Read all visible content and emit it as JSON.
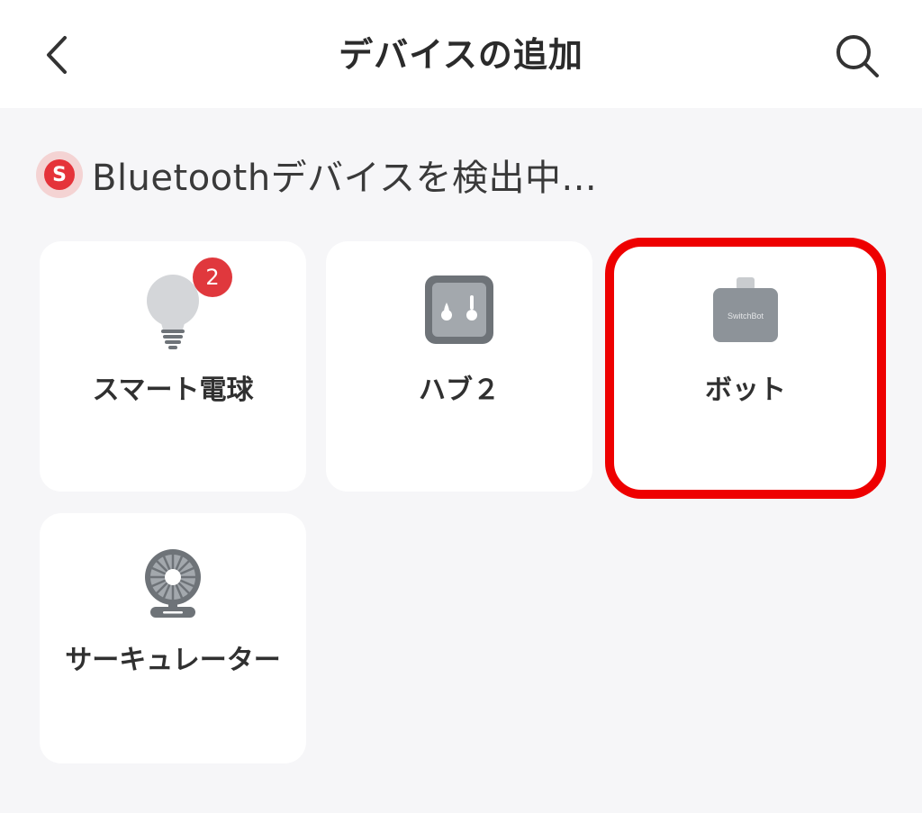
{
  "header": {
    "title": "デバイスの追加"
  },
  "scan": {
    "logo_letter": "S",
    "status_text": "Bluetoothデバイスを検出中..."
  },
  "devices": [
    {
      "label": "スマート電球",
      "icon": "light-bulb-icon",
      "badge": "2"
    },
    {
      "label": "ハブ２",
      "icon": "hub-icon"
    },
    {
      "label": "ボット",
      "icon": "switchbot-bot-icon",
      "icon_text": "SwitchBot",
      "highlighted": true
    },
    {
      "label": "サーキュレーター",
      "icon": "circulator-fan-icon"
    }
  ],
  "colors": {
    "accent_red": "#e0383d",
    "highlight": "#ee0000",
    "icon_gray": "#8d9399"
  }
}
